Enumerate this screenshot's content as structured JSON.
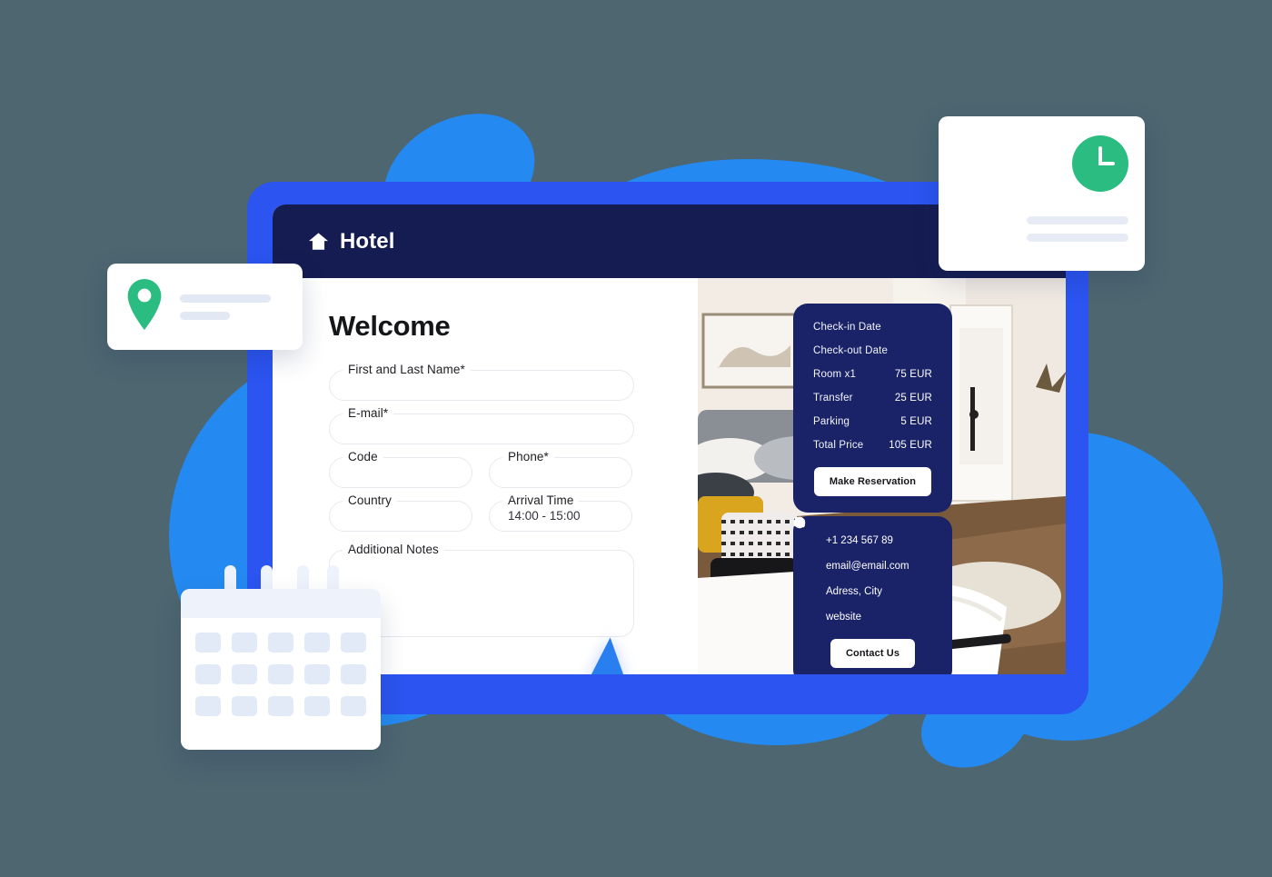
{
  "background": {
    "page_color": "#4d6670",
    "blob_color": "#2489f0",
    "frame_color": "#2b54f0"
  },
  "window": {
    "titlebar": {
      "home_icon": "home-icon",
      "brand": "Hotel",
      "menu_dots": [
        "dot",
        "dot",
        "dot"
      ]
    }
  },
  "form": {
    "heading": "Welcome",
    "fields": [
      {
        "label": "First and Last Name*",
        "value": "",
        "type": "text"
      },
      {
        "label": "E-mail*",
        "value": "",
        "type": "email"
      },
      {
        "label": "Code",
        "value": "",
        "type": "text"
      },
      {
        "label": "Phone*",
        "value": "",
        "type": "tel"
      },
      {
        "label": "Country",
        "value": "",
        "type": "text"
      },
      {
        "label": "Arrival Time",
        "value": "14:00 - 15:00",
        "type": "text"
      },
      {
        "label": "Additional Notes",
        "value": "",
        "type": "textarea"
      }
    ],
    "cursor_icon": "mouse-pointer-icon"
  },
  "summary": {
    "rows": [
      {
        "label": "Check-in Date",
        "value": ""
      },
      {
        "label": "Check-out Date",
        "value": ""
      },
      {
        "label": "Room x1",
        "value": "75 EUR"
      },
      {
        "label": "Transfer",
        "value": "25 EUR"
      },
      {
        "label": "Parking",
        "value": "5 EUR"
      },
      {
        "label": "Total Price",
        "value": "105 EUR"
      }
    ],
    "button": "Make Reservation",
    "card_color": "#1a2268"
  },
  "contact": {
    "items": [
      {
        "icon": "phone-icon",
        "text": "+1 234 567 89"
      },
      {
        "icon": "mail-icon",
        "text": "email@email.com"
      },
      {
        "icon": "location-pin-icon",
        "text": "Adress, City"
      },
      {
        "icon": "globe-icon",
        "text": "website"
      }
    ],
    "button": "Contact Us"
  },
  "floating_cards": {
    "location_card": {
      "icon": "location-pin-icon",
      "icon_color": "#2bbc82",
      "bars": 2
    },
    "clock_card": {
      "icon": "clock-icon",
      "icon_color": "#2bbc82",
      "bars": 2
    },
    "calendar_card": {
      "icon": "calendar-icon",
      "rows": 3,
      "columns": 5,
      "rings": 4
    }
  }
}
